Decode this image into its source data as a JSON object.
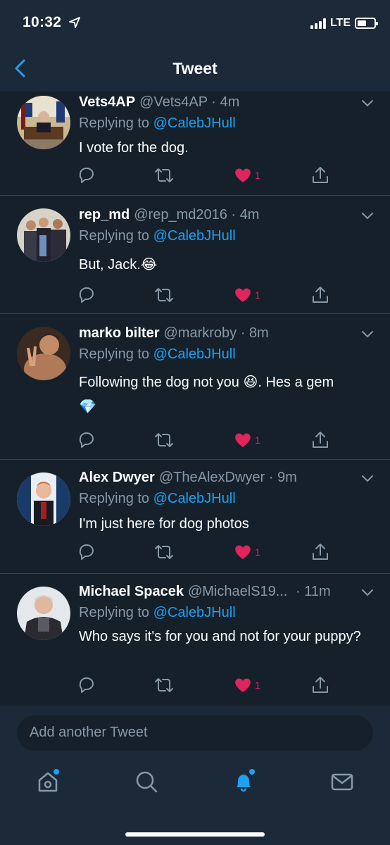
{
  "status_bar": {
    "time": "10:32",
    "network": "LTE"
  },
  "header": {
    "title": "Tweet"
  },
  "replies": [
    {
      "name": "Vets4AP",
      "handle": "@Vets4AP",
      "time": "· 4m",
      "replying_prefix": "Replying to ",
      "replying_to": "@CalebJHull",
      "text": "I vote for the dog.",
      "likes": "1"
    },
    {
      "name": "rep_md",
      "handle": "@rep_md2016",
      "time": "· 4m",
      "replying_prefix": "Replying to ",
      "replying_to": "@CalebJHull",
      "text": "But, Jack.😂",
      "likes": "1"
    },
    {
      "name": "marko bilter",
      "handle": "@markroby",
      "time": "· 8m",
      "replying_prefix": "Replying to ",
      "replying_to": "@CalebJHull",
      "text": "Following the dog not you 😆. Hes a gem 💎",
      "likes": "1"
    },
    {
      "name": "Alex Dwyer",
      "handle": "@TheAlexDwyer",
      "time": "· 9m",
      "replying_prefix": "Replying to ",
      "replying_to": "@CalebJHull",
      "text": "I'm just here for dog photos",
      "likes": "1"
    },
    {
      "name": "Michael Spacek",
      "handle": "@MichaelS19...",
      "time": "· 11m",
      "replying_prefix": "Replying to ",
      "replying_to": "@CalebJHull",
      "text": "Who says it's for you and not for your puppy?",
      "likes": "1"
    }
  ],
  "compose": {
    "placeholder": "Add another Tweet"
  },
  "tabs": [
    {
      "icon": "home-icon",
      "badge": true
    },
    {
      "icon": "search-icon",
      "badge": false
    },
    {
      "icon": "notifications-icon",
      "badge": true,
      "active": true
    },
    {
      "icon": "messages-icon",
      "badge": false
    }
  ],
  "colors": {
    "background": "#15202b",
    "header": "#1c2938",
    "accent": "#1da1f2",
    "muted": "#8899a6",
    "like": "#e0245e"
  }
}
